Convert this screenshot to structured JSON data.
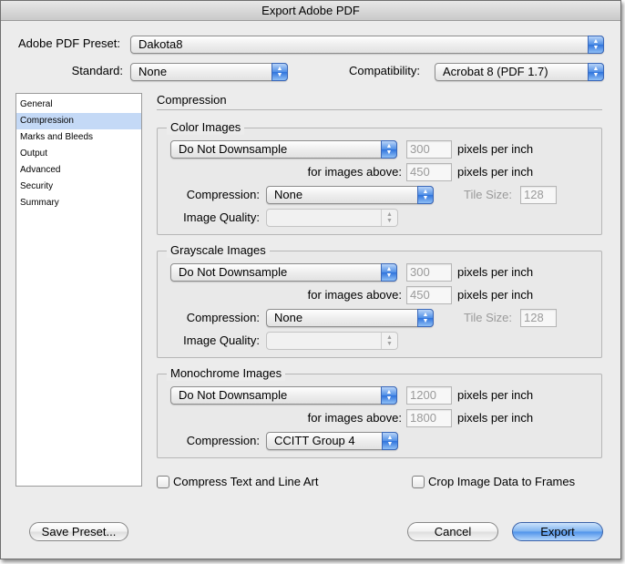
{
  "window": {
    "title": "Export Adobe PDF"
  },
  "preset": {
    "label": "Adobe PDF Preset:",
    "value": "Dakota8"
  },
  "standard": {
    "label": "Standard:",
    "value": "None"
  },
  "compatibility": {
    "label": "Compatibility:",
    "value": "Acrobat 8 (PDF 1.7)"
  },
  "sidebar": {
    "items": [
      {
        "label": "General"
      },
      {
        "label": "Compression"
      },
      {
        "label": "Marks and Bleeds"
      },
      {
        "label": "Output"
      },
      {
        "label": "Advanced"
      },
      {
        "label": "Security"
      },
      {
        "label": "Summary"
      }
    ],
    "selected_index": 1
  },
  "section_title": "Compression",
  "color_images": {
    "title": "Color Images",
    "downsample": "Do Not Downsample",
    "ppi": "300",
    "ppi_unit": "pixels per inch",
    "above_label": "for images above:",
    "above": "450",
    "above_unit": "pixels per inch",
    "compression_label": "Compression:",
    "compression": "None",
    "tile_label": "Tile Size:",
    "tile": "128",
    "quality_label": "Image Quality:",
    "quality": ""
  },
  "grayscale_images": {
    "title": "Grayscale Images",
    "downsample": "Do Not Downsample",
    "ppi": "300",
    "ppi_unit": "pixels per inch",
    "above_label": "for images above:",
    "above": "450",
    "above_unit": "pixels per inch",
    "compression_label": "Compression:",
    "compression": "None",
    "tile_label": "Tile Size:",
    "tile": "128",
    "quality_label": "Image Quality:",
    "quality": ""
  },
  "monochrome_images": {
    "title": "Monochrome Images",
    "downsample": "Do Not Downsample",
    "ppi": "1200",
    "ppi_unit": "pixels per inch",
    "above_label": "for images above:",
    "above": "1800",
    "above_unit": "pixels per inch",
    "compression_label": "Compression:",
    "compression": "CCITT Group 4"
  },
  "options": {
    "compress_text": {
      "label": "Compress Text and Line Art",
      "checked": false
    },
    "crop_images": {
      "label": "Crop Image Data to Frames",
      "checked": false
    }
  },
  "buttons": {
    "save_preset": "Save Preset...",
    "cancel": "Cancel",
    "export": "Export"
  },
  "colors": {
    "accent": "#4f8ee6",
    "sidebar_selection": "#c4d9f6",
    "window_bg": "#ececec"
  }
}
